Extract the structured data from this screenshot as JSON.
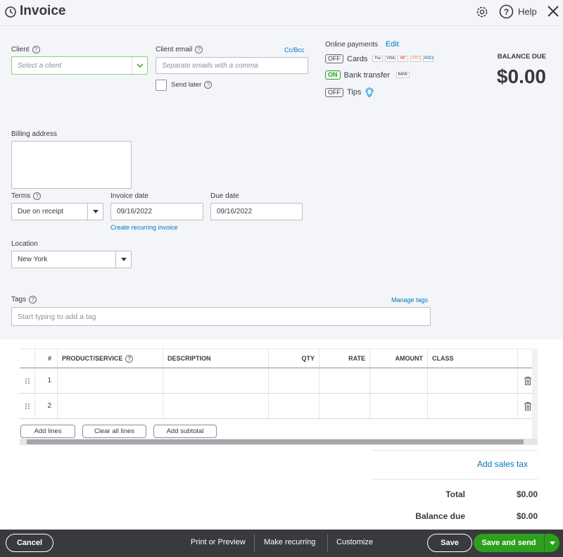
{
  "header": {
    "title": "Invoice",
    "help_label": "Help"
  },
  "client": {
    "label": "Client",
    "placeholder": "Select a client"
  },
  "client_email": {
    "label": "Client email",
    "placeholder": "Separate emails with a comma",
    "cc_bcc": "Cc/Bcc",
    "send_later": "Send later"
  },
  "online_payments": {
    "label": "Online payments",
    "edit": "Edit",
    "cards": {
      "state": "OFF",
      "label": "Cards",
      "badges": [
        "Pay",
        "VISA",
        "MC",
        "DISC",
        "AMEX"
      ]
    },
    "bank": {
      "state": "ON",
      "label": "Bank transfer",
      "badge": "BANK"
    },
    "tips": {
      "state": "OFF",
      "label": "Tips"
    }
  },
  "balance": {
    "label": "BALANCE DUE",
    "amount": "$0.00"
  },
  "billing": {
    "label": "Billing address"
  },
  "terms": {
    "label": "Terms",
    "value": "Due on receipt"
  },
  "invoice_date": {
    "label": "Invoice date",
    "value": "09/16/2022",
    "recurring_link": "Create recurring invoice"
  },
  "due_date": {
    "label": "Due date",
    "value": "09/16/2022"
  },
  "location": {
    "label": "Location",
    "value": "New York"
  },
  "tags": {
    "label": "Tags",
    "manage": "Manage tags",
    "placeholder": "Start typing to add a tag"
  },
  "table": {
    "headers": {
      "num": "#",
      "product": "PRODUCT/SERVICE",
      "description": "DESCRIPTION",
      "qty": "QTY",
      "rate": "RATE",
      "amount": "AMOUNT",
      "class": "CLASS"
    },
    "rows": [
      {
        "num": "1"
      },
      {
        "num": "2"
      }
    ],
    "add_lines": "Add lines",
    "clear_all": "Clear all lines",
    "add_subtotal": "Add subtotal"
  },
  "totals": {
    "add_sales_tax": "Add sales tax",
    "total_label": "Total",
    "total_value": "$0.00",
    "balance_due_label": "Balance due",
    "balance_due_value": "$0.00"
  },
  "footer": {
    "cancel": "Cancel",
    "print_preview": "Print or Preview",
    "make_recurring": "Make recurring",
    "customize": "Customize",
    "save": "Save",
    "save_and_send": "Save and send"
  },
  "colors": {
    "accent_green": "#2ca01c",
    "link_blue": "#0077c5",
    "footer_bg": "#393a3d"
  }
}
